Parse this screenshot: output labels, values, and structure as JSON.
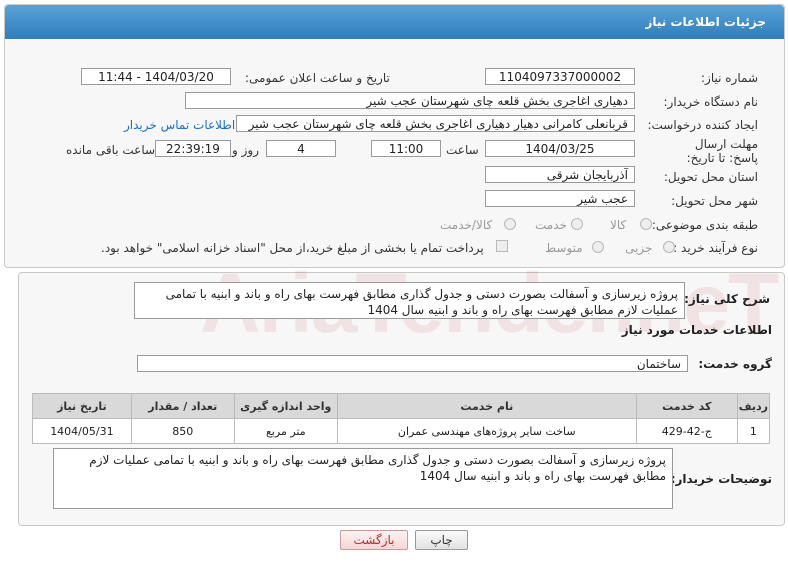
{
  "header": {
    "title": "جزئیات اطلاعات نیاز"
  },
  "form": {
    "need_number_label": "شماره نیاز:",
    "need_number": "1104097337000002",
    "announce_label": "تاریخ و ساعت اعلان عمومی:",
    "announce_value": "1404/03/20 - 11:44",
    "buyer_label": "نام دستگاه خریدار:",
    "buyer_value": "دهیاری اغاجری بخش قلعه چای شهرستان عجب شیر",
    "creator_label": "ایجاد کننده درخواست:",
    "creator_value": "قربانعلی کامرانی دهیار دهیاری اغاجری بخش قلعه چای شهرستان عجب شیر",
    "contact_link": "اطلاعات تماس خریدار",
    "deadline_label": "مهلت ارسال پاسخ: تا تاریخ:",
    "deadline_date": "1404/03/25",
    "time_label": "ساعت",
    "deadline_time": "11:00",
    "days_value": "4",
    "days_label": "روز و",
    "remaining_time": "22:39:19",
    "remaining_label": "ساعت باقی مانده",
    "province_label": "استان محل تحویل:",
    "province_value": "آذربایجان شرقی",
    "city_label": "شهر محل تحویل:",
    "city_value": "عجب شیر",
    "category_label": "طبقه بندی موضوعی:",
    "category_options": [
      "کالا",
      "خدمت",
      "کالا/خدمت"
    ],
    "process_label": "نوع فرآیند خرید :",
    "process_options": [
      "جزیی",
      "متوسط"
    ],
    "payment_note": "پرداخت تمام یا بخشی از مبلغ خرید،از محل \"اسناد خزانه اسلامی\" خواهد بود."
  },
  "description": {
    "label": "شرح کلی نیاز:",
    "text": "پروژه زیرسازی و آسفالت بصورت دستی و جدول گذاری مطابق فهرست بهای راه و باند و ابنیه با تمامی عملیات لازم مطابق فهرست بهای راه و باند و ابنیه سال 1404"
  },
  "services": {
    "title": "اطلاعات خدمات مورد نیاز",
    "group_label": "گروه خدمت:",
    "group_value": "ساختمان",
    "columns": [
      "ردیف",
      "کد خدمت",
      "نام خدمت",
      "واحد اندازه گیری",
      "تعداد / مقدار",
      "تاریخ نیاز"
    ],
    "rows": [
      {
        "row": "1",
        "code": "ج-42-429",
        "name": "ساخت سایر پروژه‌های مهندسی عمران",
        "unit": "متر مربع",
        "qty": "850",
        "date": "1404/05/31"
      }
    ]
  },
  "buyer_notes": {
    "label": "توضیحات خریدار:",
    "text": "پروژه زیرسازی و آسفالت بصورت دستی و جدول گذاری مطابق فهرست بهای راه و باند و ابنیه با تمامی عملیات لازم مطابق فهرست بهای راه و باند و ابنیه سال 1404"
  },
  "buttons": {
    "print": "چاپ",
    "back": "بازگشت"
  },
  "watermark": "AriaTender.neT"
}
